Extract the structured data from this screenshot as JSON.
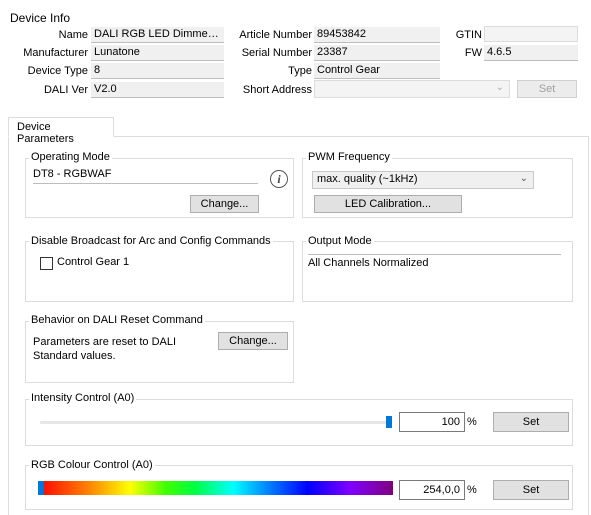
{
  "device_info": {
    "title": "Device Info",
    "name_label": "Name",
    "name_value": "DALI RGB LED Dimmer C...",
    "manufacturer_label": "Manufacturer",
    "manufacturer_value": "Lunatone",
    "device_type_label": "Device Type",
    "device_type_value": "8",
    "dali_ver_label": "DALI Ver",
    "dali_ver_value": "V2.0",
    "article_label": "Article Number",
    "article_value": "89453842",
    "serial_label": "Serial Number",
    "serial_value": "23387",
    "type_label": "Type",
    "type_value": "Control Gear",
    "short_address_label": "Short Address",
    "short_address_value": "",
    "gtin_label": "GTIN",
    "gtin_value": "",
    "fw_label": "FW",
    "fw_value": "4.6.5",
    "set_label": "Set"
  },
  "tab": {
    "label": "Device Parameters"
  },
  "operating_mode": {
    "title": "Operating Mode",
    "value": "DT8 - RGBWAF",
    "change_label": "Change..."
  },
  "pwm": {
    "title": "PWM Frequency",
    "selected": "max. quality (~1kHz)",
    "calibration_label": "LED Calibration..."
  },
  "broadcast": {
    "title": "Disable Broadcast for Arc and Config Commands",
    "checkbox_label": "Control Gear 1",
    "checked": false
  },
  "output_mode": {
    "title": "Output Mode",
    "value": "All Channels Normalized"
  },
  "reset_behavior": {
    "title": "Behavior on DALI Reset Command",
    "text": "Parameters are reset to DALI Standard values.",
    "change_label": "Change..."
  },
  "intensity": {
    "title": "Intensity Control (A0)",
    "value": "100",
    "unit": "%",
    "level": 1.0,
    "set_label": "Set"
  },
  "rgb": {
    "title": "RGB Colour Control (A0)",
    "value": "254,0,0",
    "unit": "%",
    "set_label": "Set"
  },
  "colors": {
    "accent": "#0078d7",
    "group_border": "#dcdcdc",
    "button_bg": "#e1e1e1"
  },
  "icons": {
    "info": "info-icon",
    "dropdown": "chevron-down-icon"
  }
}
